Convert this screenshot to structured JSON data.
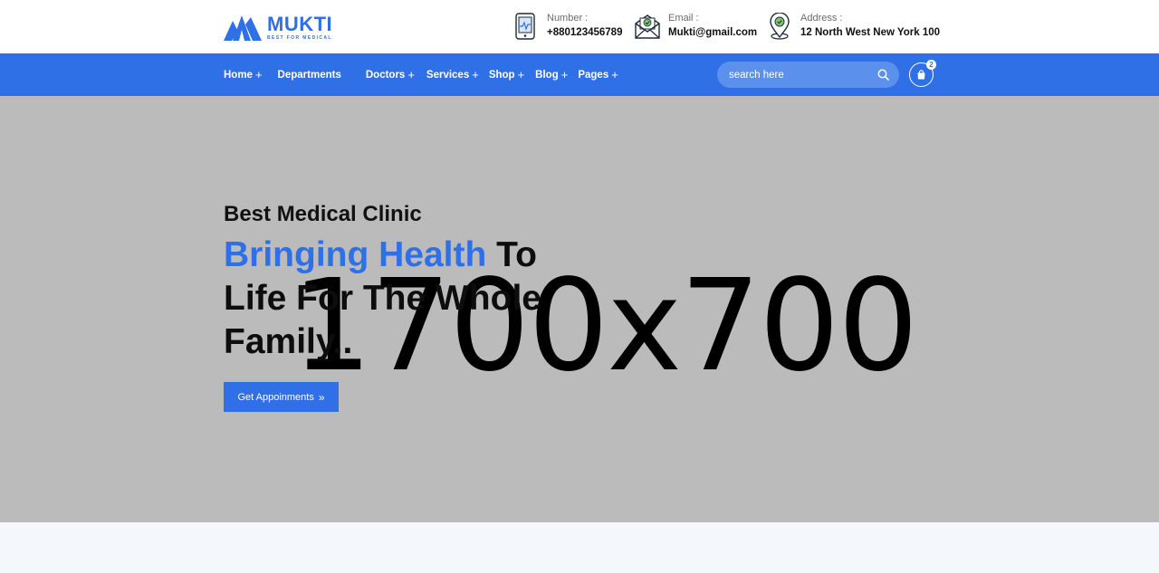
{
  "brand": {
    "name": "MUKTI",
    "tagline": "BEST FOR MEDICAL",
    "color": "#3070e6"
  },
  "contacts": [
    {
      "label": "Number :",
      "value": "+880123456789",
      "icon": "phone-icon"
    },
    {
      "label": "Email :",
      "value": "Mukti@gmail.com",
      "icon": "mail-icon"
    },
    {
      "label": "Address :",
      "value": "12 North West New York 100",
      "icon": "location-icon"
    }
  ],
  "nav": {
    "items": [
      {
        "label": "Home",
        "plus": "+"
      },
      {
        "label": "Departments",
        "plus": ""
      },
      {
        "label": "Doctors",
        "plus": "+"
      },
      {
        "label": "Services",
        "plus": "+"
      },
      {
        "label": "Shop",
        "plus": "+"
      },
      {
        "label": "Blog",
        "plus": "+"
      },
      {
        "label": "Pages",
        "plus": "+"
      }
    ],
    "search_placeholder": "search here",
    "cart_count": "2",
    "background": "#3070e6"
  },
  "hero": {
    "subtitle": "Best Medical Clinic",
    "headline_accent": "Bringing Health",
    "headline_rest": " To Life For The Whole Family..",
    "cta_label": "Get Appoinments",
    "cta_arrow": "»",
    "placeholder_text": "1700x700",
    "background": "#bbbbbb"
  }
}
